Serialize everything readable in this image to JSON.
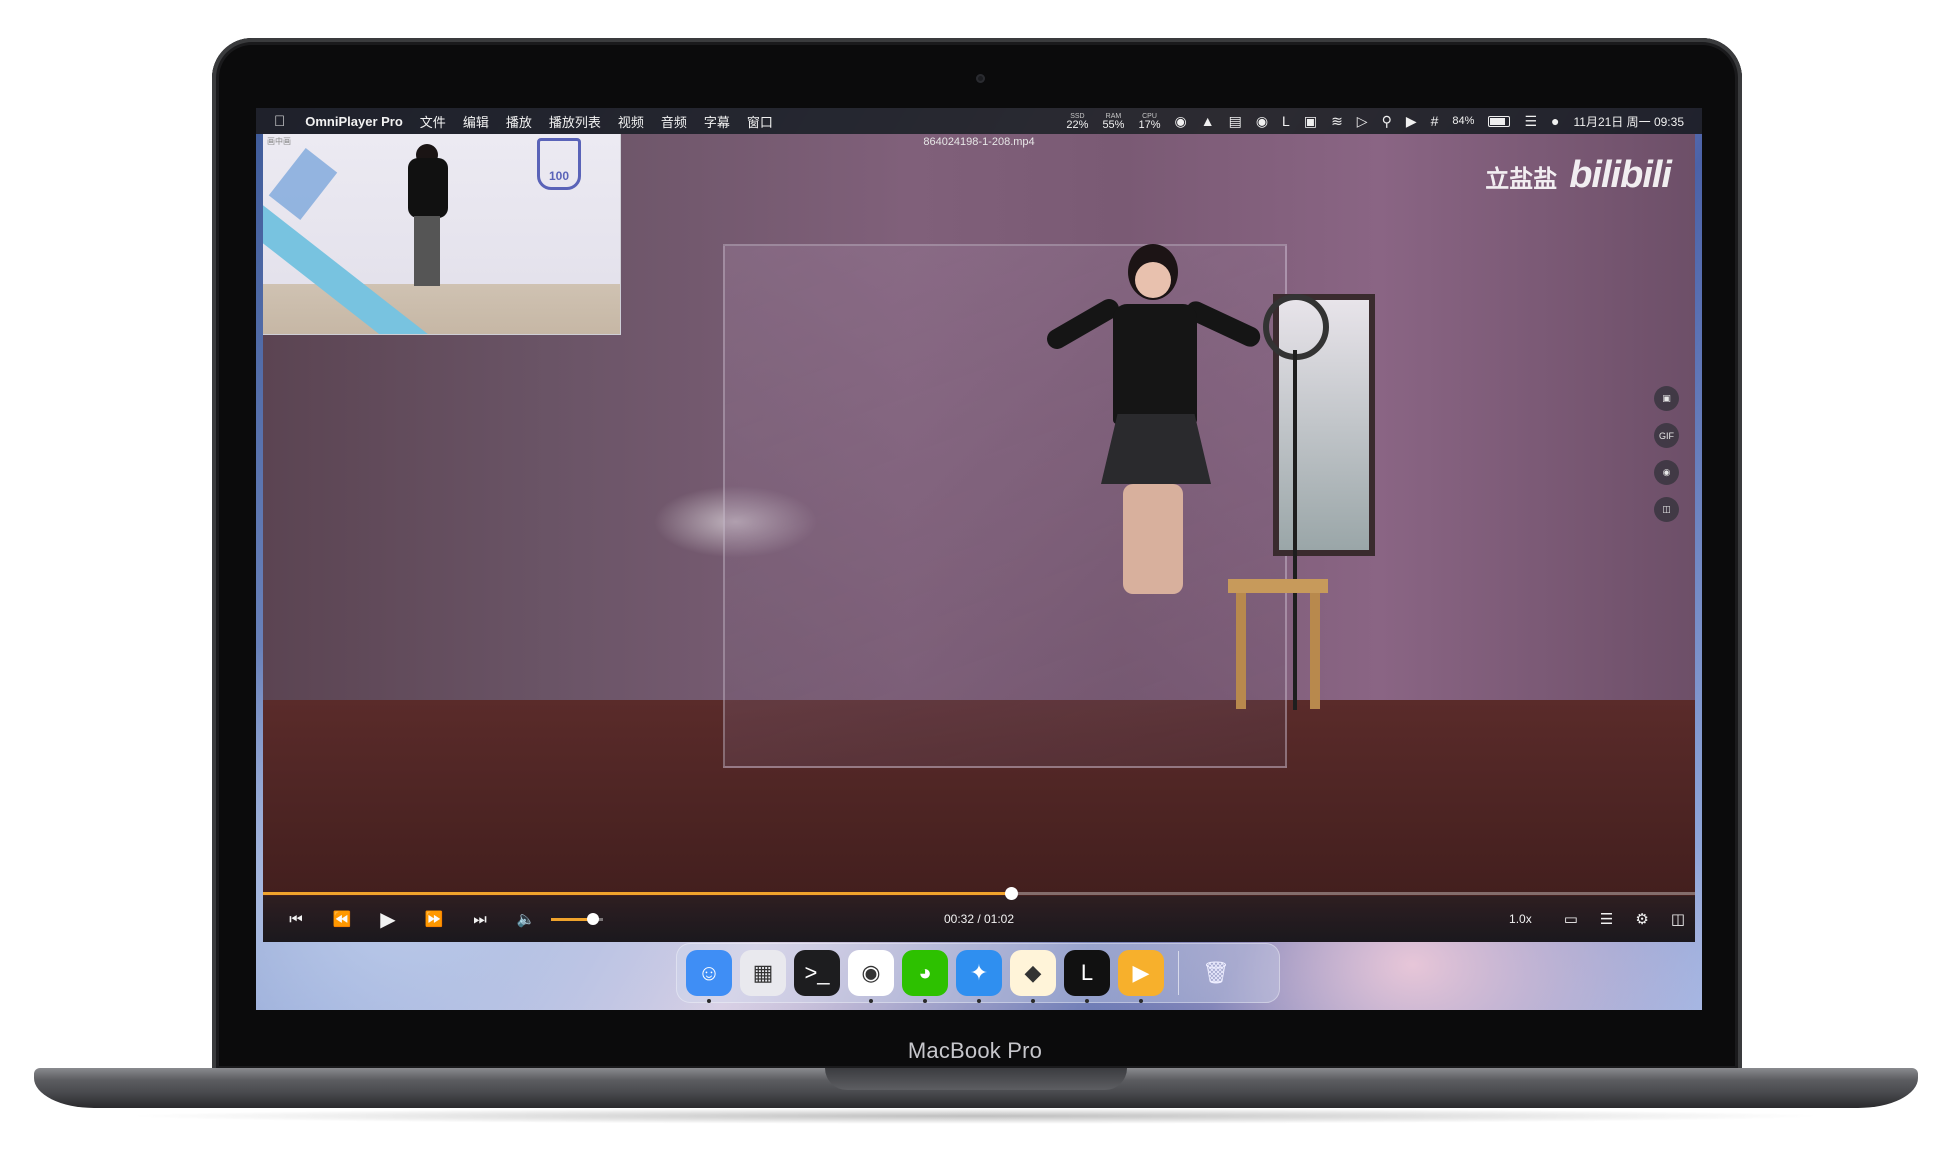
{
  "device": {
    "label": "MacBook Pro"
  },
  "menubar": {
    "app_name": "OmniPlayer Pro",
    "menus": [
      "文件",
      "编辑",
      "播放",
      "播放列表",
      "视频",
      "音频",
      "字幕",
      "窗口"
    ],
    "stats": [
      {
        "key": "SSD",
        "value": "22%"
      },
      {
        "key": "RAM",
        "value": "55%"
      },
      {
        "key": "CPU",
        "value": "17%"
      }
    ],
    "battery_text": "84%",
    "battery_level": 0.84,
    "clock": "11月21日 周一 09:35"
  },
  "player": {
    "file_title": "864024198-1-208.mp4",
    "watermark_cn": "立盐盐",
    "watermark_logo": "bilibili",
    "pip_tag": "画中画",
    "pip_logo_text": "100",
    "progress_fraction": 0.5226,
    "volume_fraction": 0.8,
    "time": "00:32 / 01:02",
    "speed": "1.0x",
    "side_tools": [
      "crop-icon",
      "GIF",
      "camera-record-icon",
      "layout-icon"
    ],
    "side_tool_gif_label": "GIF"
  },
  "dock": {
    "apps": [
      {
        "name": "finder-icon",
        "glyph": "☺",
        "bg": "#3f8ef5",
        "running": true
      },
      {
        "name": "launchpad-icon",
        "glyph": "▦",
        "bg": "#e9e9ee",
        "running": false
      },
      {
        "name": "terminal-icon",
        "glyph": ">_",
        "bg": "#1d1d1f",
        "running": false
      },
      {
        "name": "chrome-icon",
        "glyph": "◉",
        "bg": "#ffffff",
        "running": true
      },
      {
        "name": "wechat-icon",
        "glyph": "◕",
        "bg": "#2dc100",
        "running": true
      },
      {
        "name": "safari-icon",
        "glyph": "✦",
        "bg": "#2f8ff0",
        "running": true
      },
      {
        "name": "sketch-icon",
        "glyph": "◆",
        "bg": "#fff4d9",
        "running": true
      },
      {
        "name": "lasso-icon",
        "glyph": "L",
        "bg": "#111111",
        "running": true
      },
      {
        "name": "omniplayer-icon",
        "glyph": "▶",
        "bg": "#f7b02c",
        "running": true
      }
    ],
    "trash": {
      "name": "trash-icon",
      "glyph": "🗑"
    }
  }
}
